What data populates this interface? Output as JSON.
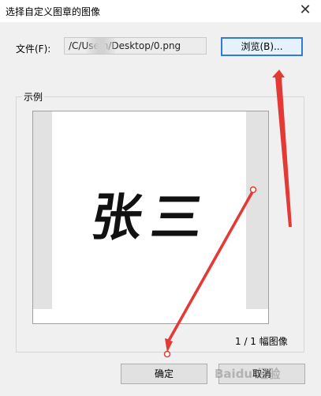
{
  "window": {
    "title": "选择自定义图章的图像",
    "close_glyph": "✕"
  },
  "file": {
    "label": "文件(F):",
    "value": "/C/Use    n/Desktop/0.png"
  },
  "browse_label": "浏览(B)...",
  "group": {
    "label": "示例"
  },
  "preview": {
    "seal_text": "张三",
    "count": "1 / 1 幅图像"
  },
  "ok_label": "确定",
  "cancel_label": "取消",
  "watermark": "Baidu 经验",
  "colors": {
    "annotation": "#e53935",
    "focus": "#2f7bd6"
  }
}
